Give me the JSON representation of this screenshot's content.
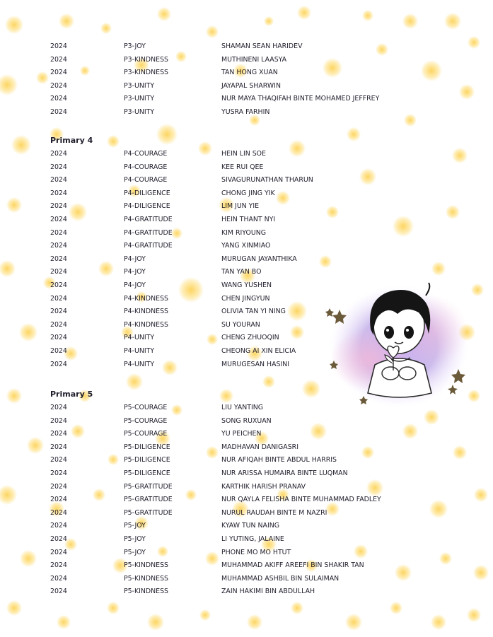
{
  "sections": [
    {
      "title": "",
      "rows": [
        {
          "year": "2024",
          "class": "P3-JOY",
          "name": "SHAMAN SEAN HARIDEV"
        },
        {
          "year": "2024",
          "class": "P3-KINDNESS",
          "name": "MUTHINENI LAASYA"
        },
        {
          "year": "2024",
          "class": "P3-KINDNESS",
          "name": "TAN HONG XUAN"
        },
        {
          "year": "2024",
          "class": "P3-UNITY",
          "name": "JAYAPAL SHARWIN"
        },
        {
          "year": "2024",
          "class": "P3-UNITY",
          "name": "NUR MAYA THAQIFAH BINTE MOHAMED JEFFREY"
        },
        {
          "year": "2024",
          "class": "P3-UNITY",
          "name": "YUSRA FARHIN"
        }
      ]
    },
    {
      "title": "Primary 4",
      "rows": [
        {
          "year": "2024",
          "class": "P4-COURAGE",
          "name": "HEIN LIN SOE"
        },
        {
          "year": "2024",
          "class": "P4-COURAGE",
          "name": "KEE RUI QEE"
        },
        {
          "year": "2024",
          "class": "P4-COURAGE",
          "name": "SIVAGURUNATHAN THARUN"
        },
        {
          "year": "2024",
          "class": "P4-DILIGENCE",
          "name": "CHONG JING YIK"
        },
        {
          "year": "2024",
          "class": "P4-DILIGENCE",
          "name": "LIM JUN YIE"
        },
        {
          "year": "2024",
          "class": "P4-GRATITUDE",
          "name": "HEIN THANT NYI"
        },
        {
          "year": "2024",
          "class": "P4-GRATITUDE",
          "name": "KIM RIYOUNG"
        },
        {
          "year": "2024",
          "class": "P4-GRATITUDE",
          "name": "YANG XINMIAO"
        },
        {
          "year": "2024",
          "class": "P4-JOY",
          "name": "MURUGAN JAYANTHIKA"
        },
        {
          "year": "2024",
          "class": "P4-JOY",
          "name": "TAN YAN BO"
        },
        {
          "year": "2024",
          "class": "P4-JOY",
          "name": "WANG YUSHEN"
        },
        {
          "year": "2024",
          "class": "P4-KINDNESS",
          "name": "CHEN JINGYUN"
        },
        {
          "year": "2024",
          "class": "P4-KINDNESS",
          "name": "OLIVIA TAN YI NING"
        },
        {
          "year": "2024",
          "class": "P4-KINDNESS",
          "name": "SU YOURAN"
        },
        {
          "year": "2024",
          "class": "P4-UNITY",
          "name": "CHENG ZHUOQIN"
        },
        {
          "year": "2024",
          "class": "P4-UNITY",
          "name": "CHEONG AI XIN ELICIA"
        },
        {
          "year": "2024",
          "class": "P4-UNITY",
          "name": "MURUGESAN HASINI"
        }
      ]
    },
    {
      "title": "Primary 5",
      "rows": [
        {
          "year": "2024",
          "class": "P5-COURAGE",
          "name": "LIU YANTING"
        },
        {
          "year": "2024",
          "class": "P5-COURAGE",
          "name": "SONG RUXUAN"
        },
        {
          "year": "2024",
          "class": "P5-COURAGE",
          "name": "YU PEICHEN"
        },
        {
          "year": "2024",
          "class": "P5-DILIGENCE",
          "name": "MADHAVAN DANIGASRI"
        },
        {
          "year": "2024",
          "class": "P5-DILIGENCE",
          "name": "NUR AFIQAH BINTE ABDUL HARRIS"
        },
        {
          "year": "2024",
          "class": "P5-DILIGENCE",
          "name": "NUR ARISSA HUMAIRA BINTE LUQMAN"
        },
        {
          "year": "2024",
          "class": "P5-GRATITUDE",
          "name": "KARTHIK HARISH PRANAV"
        },
        {
          "year": "2024",
          "class": "P5-GRATITUDE",
          "name": "NUR QAYLA FELISHA BINTE MUHAMMAD FADLEY"
        },
        {
          "year": "2024",
          "class": "P5-GRATITUDE",
          "name": "NURUL RAUDAH BINTE M NAZRI"
        },
        {
          "year": "2024",
          "class": "P5-JOY",
          "name": "KYAW TUN NAING"
        },
        {
          "year": "2024",
          "class": "P5-JOY",
          "name": "LI YUTING, JALAINE"
        },
        {
          "year": "2024",
          "class": "P5-JOY",
          "name": "PHONE MO MO HTUT"
        },
        {
          "year": "2024",
          "class": "P5-KINDNESS",
          "name": "MUHAMMAD AKIFF AREEFI BIN SHAKIR TAN"
        },
        {
          "year": "2024",
          "class": "P5-KINDNESS",
          "name": "MUHAMMAD ASHBIL BIN SULAIMAN"
        },
        {
          "year": "2024",
          "class": "P5-KINDNESS",
          "name": "ZAIN HAKIMI BIN ABDULLAH"
        }
      ]
    }
  ],
  "colors": {
    "text": "#1f1d2b",
    "dot_yellow": "#fccc46",
    "illustration_purple": "#b89be0"
  },
  "icons": [
    "girl-holding-flower-illustration",
    "star-icon"
  ]
}
